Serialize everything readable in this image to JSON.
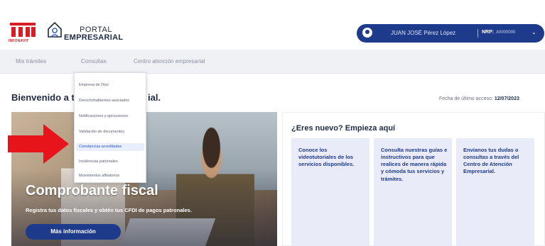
{
  "brand": {
    "infonavit_text": "INFONAVIT",
    "portal_line1": "PORTAL",
    "portal_line2": "EMPRESARIAL"
  },
  "user": {
    "name": "JUAN JOSÉ Pérez López",
    "nrp_label": "NRP:",
    "nrp_value": "A0000000"
  },
  "nav": {
    "items": [
      {
        "label": "Mis trámites"
      },
      {
        "label": "Consultas"
      },
      {
        "label": "Centro atención empresarial"
      }
    ]
  },
  "consultas_menu": {
    "items": [
      {
        "label": "Empresa de Diez"
      },
      {
        "label": "Derechohabientes asociados"
      },
      {
        "label": "Notificaciones y ejecuciones"
      },
      {
        "label": "Validación de documentos"
      },
      {
        "label": "Constancias acreditadas"
      },
      {
        "label": "Incidencias patronales"
      },
      {
        "label": "Movimientos afiliatorios"
      }
    ],
    "highlighted_index": 4
  },
  "welcome": {
    "lead": "Bienvenido a t",
    "tail": "ial."
  },
  "last_access": {
    "label": "Fecha de último acceso:",
    "date": "12/07/2023"
  },
  "hero": {
    "title": "Comprobante fiscal",
    "subtitle": "Registra tus datos fiscales y obtén tus CFDI de pagos patronales.",
    "button": "Más información"
  },
  "new_user_panel": {
    "title": "¿Eres nuevo? Empieza aquí",
    "cards": [
      {
        "text": "Conoce los videotutoriales de los servicios disponibles."
      },
      {
        "text": "Consulta nuestras guías e instructivos para que realices de manera rápida y cómoda tus servicios y trámites."
      },
      {
        "text": "Envíanos tus dudas o consultas a través del Centro de Atención Empresarial."
      }
    ]
  },
  "colors": {
    "primary": "#1e3a8a",
    "brand_red": "#d81e24",
    "card_bg": "#e9ecf8",
    "annotation_arrow": "#e8141c"
  },
  "icons": [
    "infonavit-logo",
    "portal-house-icon",
    "user-icon",
    "chevron-down-icon",
    "annotation-arrow"
  ]
}
